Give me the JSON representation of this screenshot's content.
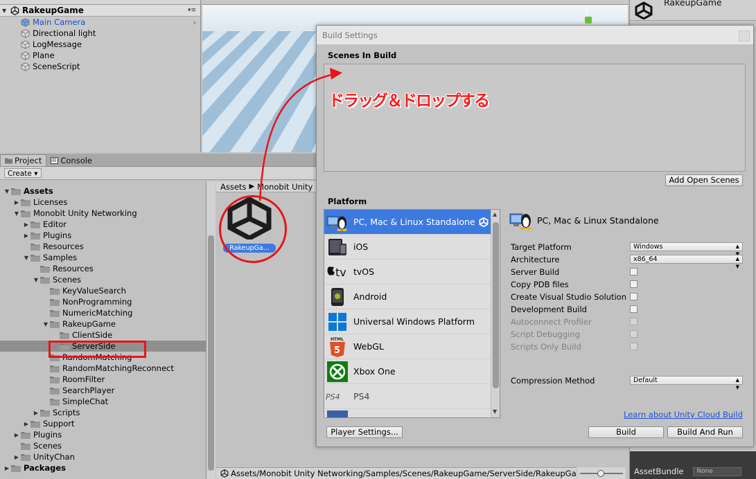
{
  "hierarchy": {
    "scene_name": "RakeupGame",
    "items": [
      {
        "label": "Main Camera",
        "selected": true
      },
      {
        "label": "Directional light"
      },
      {
        "label": "LogMessage"
      },
      {
        "label": "Plane"
      },
      {
        "label": "SceneScript"
      }
    ]
  },
  "scene_view": {
    "gizmo_axis": "y"
  },
  "inspector": {
    "title": "RakeupGame",
    "asset_bundle_label": "AssetBundle",
    "asset_bundle_value": "None"
  },
  "project": {
    "tabs": [
      {
        "label": "Project"
      },
      {
        "label": "Console"
      }
    ],
    "create_label": "Create ▾",
    "tree": [
      {
        "label": "Assets",
        "level": 0,
        "tw": "▼",
        "bold": true
      },
      {
        "label": "Licenses",
        "level": 1,
        "tw": "▶"
      },
      {
        "label": "Monobit Unity Networking",
        "level": 1,
        "tw": "▼"
      },
      {
        "label": "Editor",
        "level": 2,
        "tw": "▶"
      },
      {
        "label": "Plugins",
        "level": 2,
        "tw": "▶"
      },
      {
        "label": "Resources",
        "level": 2,
        "tw": ""
      },
      {
        "label": "Samples",
        "level": 2,
        "tw": "▼"
      },
      {
        "label": "Resources",
        "level": 3,
        "tw": ""
      },
      {
        "label": "Scenes",
        "level": 3,
        "tw": "▼"
      },
      {
        "label": "KeyValueSearch",
        "level": 4,
        "tw": ""
      },
      {
        "label": "NonProgramming",
        "level": 4,
        "tw": ""
      },
      {
        "label": "NumericMatching",
        "level": 4,
        "tw": ""
      },
      {
        "label": "RakeupGame",
        "level": 4,
        "tw": "▼"
      },
      {
        "label": "ClientSide",
        "level": 5,
        "tw": ""
      },
      {
        "label": "ServerSide",
        "level": 5,
        "tw": "",
        "selected": true
      },
      {
        "label": "RandomMatching",
        "level": 4,
        "tw": ""
      },
      {
        "label": "RandomMatchingReconnect",
        "level": 4,
        "tw": ""
      },
      {
        "label": "RoomFilter",
        "level": 4,
        "tw": ""
      },
      {
        "label": "SearchPlayer",
        "level": 4,
        "tw": ""
      },
      {
        "label": "SimpleChat",
        "level": 4,
        "tw": ""
      },
      {
        "label": "Scripts",
        "level": 3,
        "tw": "▶"
      },
      {
        "label": "Support",
        "level": 2,
        "tw": "▶"
      },
      {
        "label": "Plugins",
        "level": 1,
        "tw": "▶"
      },
      {
        "label": "Scenes",
        "level": 1,
        "tw": ""
      },
      {
        "label": "UnityChan",
        "level": 1,
        "tw": "▶"
      },
      {
        "label": "Packages",
        "level": 0,
        "tw": "▶",
        "bold": true
      }
    ],
    "breadcrumb": [
      "Assets",
      "Monobit Unity"
    ],
    "asset_label": "RakeupGa...",
    "path": "Assets/Monobit Unity Networking/Samples/Scenes/RakeupGame/ServerSide/RakeupGa"
  },
  "build_settings": {
    "window_title": "Build Settings",
    "scenes_in_build_title": "Scenes In Build",
    "add_open_scenes_label": "Add Open Scenes",
    "platform_title": "Platform",
    "platforms": [
      {
        "label": "PC, Mac & Linux Standalone",
        "icon": "pc-icon",
        "selected": true
      },
      {
        "label": "iOS",
        "icon": "ios-icon"
      },
      {
        "label": "tvOS",
        "icon": "tvos-icon"
      },
      {
        "label": "Android",
        "icon": "android-icon"
      },
      {
        "label": "Universal Windows Platform",
        "icon": "windows-icon"
      },
      {
        "label": "WebGL",
        "icon": "html5-icon"
      },
      {
        "label": "Xbox One",
        "icon": "xbox-icon"
      },
      {
        "label": "PS4",
        "icon": "ps4-icon"
      }
    ],
    "selected_platform_title": "PC, Mac & Linux Standalone",
    "settings": [
      {
        "label": "Target Platform",
        "type": "dropdown",
        "value": "Windows"
      },
      {
        "label": "Architecture",
        "type": "dropdown",
        "value": "x86_64"
      },
      {
        "label": "Server Build",
        "type": "checkbox"
      },
      {
        "label": "Copy PDB files",
        "type": "checkbox"
      },
      {
        "label": "Create Visual Studio Solution",
        "type": "checkbox"
      },
      {
        "label": "Development Build",
        "type": "checkbox"
      },
      {
        "label": "Autoconnect Profiler",
        "type": "checkbox",
        "disabled": true
      },
      {
        "label": "Script Debugging",
        "type": "checkbox",
        "disabled": true
      },
      {
        "label": "Scripts Only Build",
        "type": "checkbox",
        "disabled": true
      }
    ],
    "compression_label": "Compression Method",
    "compression_value": "Default",
    "cloud_link": "Learn about Unity Cloud Build",
    "player_settings_label": "Player Settings...",
    "build_label": "Build",
    "build_and_run_label": "Build And Run"
  },
  "annotation": {
    "caption": "ドラッグ＆ドロップする",
    "color": "#e8141a"
  }
}
